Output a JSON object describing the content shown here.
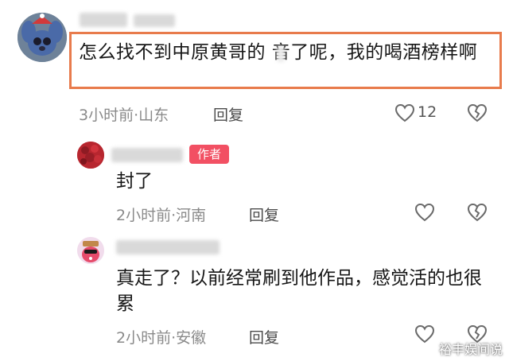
{
  "main_comment": {
    "text": "怎么找不到中原黄哥的 音了呢，我的喝酒榜样啊",
    "time": "3小时前·山东",
    "reply_label": "回复",
    "like_count": "12"
  },
  "replies": [
    {
      "badge": "作者",
      "text": "封了",
      "time": "2小时前·河南",
      "reply_label": "回复"
    },
    {
      "text": "真走了？以前经常刷到他作品，感觉活的也很累",
      "time": "2小时前·安徽",
      "reply_label": "回复"
    }
  ],
  "watermark": "裕丰娱间说",
  "colors": {
    "highlight_border": "#e87b4c",
    "author_badge": "#f25063",
    "meta_text": "#8a8a8a"
  },
  "icons": [
    "heart-outline-icon",
    "broken-heart-icon"
  ]
}
